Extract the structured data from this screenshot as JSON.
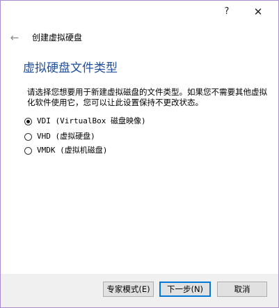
{
  "titlebar": {
    "help_label": "?",
    "close_label": "✕"
  },
  "nav": {
    "back_icon": "←",
    "title": "创建虚拟硬盘"
  },
  "page": {
    "title": "虚拟硬盘文件类型",
    "description": "请选择您想要用于新建虚拟磁盘的文件类型。如果您不需要其他虚拟化软件使用它，您可以让此设置保持不更改状态。"
  },
  "options": [
    {
      "label": "VDI (VirtualBox 磁盘映像)",
      "checked": true
    },
    {
      "label": "VHD (虚拟硬盘)",
      "checked": false
    },
    {
      "label": "VMDK (虚拟机磁盘)",
      "checked": false
    }
  ],
  "buttons": {
    "expert": "专家模式(E)",
    "next": "下一步(N)",
    "cancel": "取消"
  },
  "colors": {
    "accent": "#0078d7",
    "title": "#1f4e9c",
    "window_border": "#a98bd0",
    "footer_bg": "#f0f0f0"
  }
}
